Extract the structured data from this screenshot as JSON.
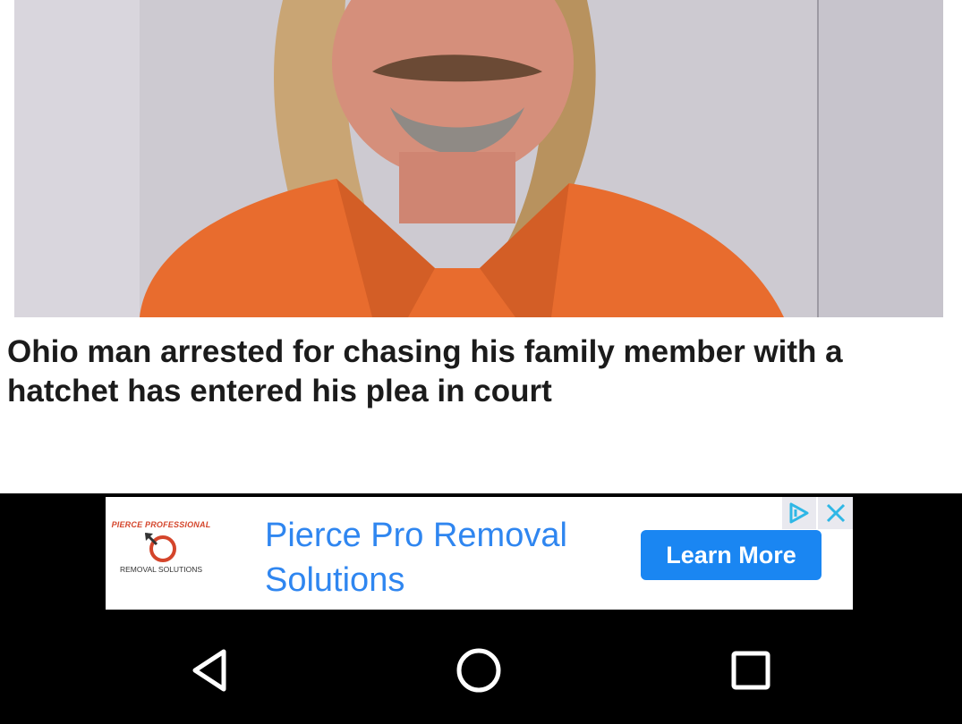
{
  "article": {
    "photo_alt": "mugshot photo",
    "headline": "Ohio man arrested for chasing his family member with a hatchet has entered his plea in court"
  },
  "ad": {
    "logo_top": "PIERCE PROFESSIONAL",
    "logo_bottom": "REMOVAL SOLUTIONS",
    "title": "Pierce Pro Removal Solutions",
    "cta_label": "Learn More",
    "adchoices_icon": "adchoices-icon",
    "close_icon": "close-icon",
    "accent_color": "#2f86f0",
    "cta_color": "#1a86f2"
  },
  "navbar": {
    "back_icon": "back-triangle-icon",
    "home_icon": "home-circle-icon",
    "recents_icon": "recents-square-icon"
  }
}
